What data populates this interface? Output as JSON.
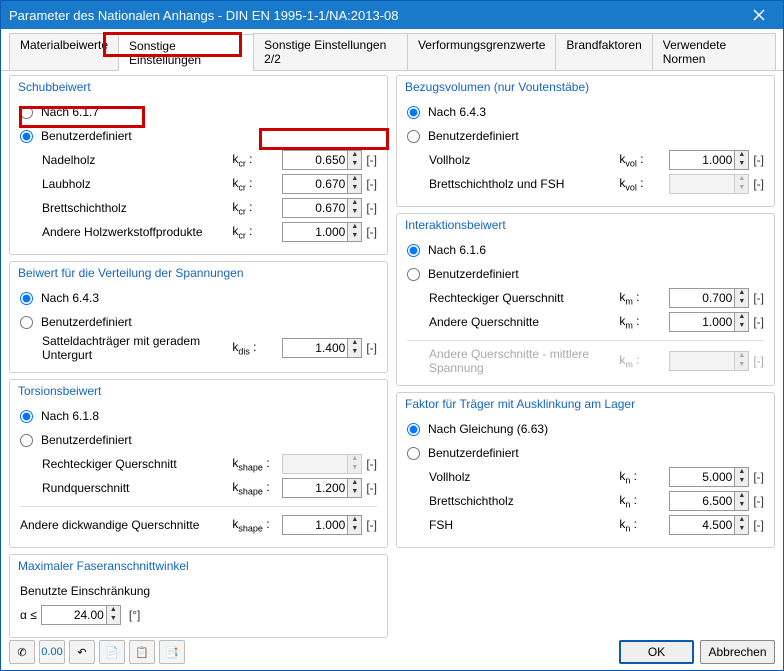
{
  "window": {
    "title": "Parameter des Nationalen Anhangs - DIN EN 1995-1-1/NA:2013-08"
  },
  "tabs": [
    "Materialbeiwerte",
    "Sonstige Einstellungen",
    "Sonstige Einstellungen 2/2",
    "Verformungsgrenzwerte",
    "Brandfaktoren",
    "Verwendete Normen"
  ],
  "groups": {
    "schub": {
      "title": "Schubbeiwert",
      "opt_a": "Nach 6.1.7",
      "opt_b": "Benutzerdefiniert",
      "rows": [
        {
          "label": "Nadelholz",
          "sym": "k<sub>cr</sub> :",
          "val": "0.650",
          "unit": "[-]"
        },
        {
          "label": "Laubholz",
          "sym": "k<sub>cr</sub> :",
          "val": "0.670",
          "unit": "[-]"
        },
        {
          "label": "Brettschichtholz",
          "sym": "k<sub>cr</sub> :",
          "val": "0.670",
          "unit": "[-]"
        },
        {
          "label": "Andere Holzwerkstoffprodukte",
          "sym": "k<sub>cr</sub> :",
          "val": "1.000",
          "unit": "[-]"
        }
      ]
    },
    "vert": {
      "title": "Beiwert für die Verteilung der Spannungen",
      "opt_a": "Nach 6.4.3",
      "opt_b": "Benutzerdefiniert",
      "row": {
        "label": "Satteldachträger mit geradem Untergurt",
        "sym": "k<sub>dis</sub> :",
        "val": "1.400",
        "unit": "[-]"
      }
    },
    "tors": {
      "title": "Torsionsbeiwert",
      "opt_a": "Nach 6.1.8",
      "opt_b": "Benutzerdefiniert",
      "rows": [
        {
          "label": "Rechteckiger Querschnitt",
          "sym": "k<sub>shape</sub> :",
          "val": "",
          "unit": "[-]"
        },
        {
          "label": "Rundquerschnitt",
          "sym": "k<sub>shape</sub> :",
          "val": "1.200",
          "unit": "[-]"
        }
      ],
      "row2": {
        "label": "Andere dickwandige Querschnitte",
        "sym": "k<sub>shape</sub> :",
        "val": "1.000",
        "unit": "[-]"
      }
    },
    "faser": {
      "title": "Maximaler Faseranschnittwinkel",
      "label": "Benutzte Einschränkung",
      "sym": "α ≤",
      "val": "24.00",
      "unit": "[°]"
    },
    "bezug": {
      "title": "Bezugsvolumen (nur Voutenstäbe)",
      "opt_a": "Nach 6.4.3",
      "opt_b": "Benutzerdefiniert",
      "rows": [
        {
          "label": "Vollholz",
          "sym": "k<sub>vol</sub> :",
          "val": "1.000",
          "unit": "[-]"
        },
        {
          "label": "Brettschichtholz und FSH",
          "sym": "k<sub>vol</sub> :",
          "val": "",
          "unit": "[-]"
        }
      ]
    },
    "inter": {
      "title": "Interaktionsbeiwert",
      "opt_a": "Nach 6.1.6",
      "opt_b": "Benutzerdefiniert",
      "rows": [
        {
          "label": "Rechteckiger Querschnitt",
          "sym": "k<sub>m</sub> :",
          "val": "0.700",
          "unit": "[-]"
        },
        {
          "label": "Andere Querschnitte",
          "sym": "k<sub>m</sub> :",
          "val": "1.000",
          "unit": "[-]"
        }
      ],
      "disabled_row": {
        "label": "Andere Querschnitte - mittlere Spannung",
        "sym": "k<sub>m</sub> :",
        "val": "",
        "unit": "[-]"
      }
    },
    "ausk": {
      "title": "Faktor für Träger mit Ausklinkung am Lager",
      "opt_a": "Nach Gleichung (6.63)",
      "opt_b": "Benutzerdefiniert",
      "rows": [
        {
          "label": "Vollholz",
          "sym": "k<sub>n</sub> :",
          "val": "5.000",
          "unit": "[-]"
        },
        {
          "label": "Brettschichtholz",
          "sym": "k<sub>n</sub> :",
          "val": "6.500",
          "unit": "[-]"
        },
        {
          "label": "FSH",
          "sym": "k<sub>n</sub> :",
          "val": "4.500",
          "unit": "[-]"
        }
      ]
    }
  },
  "buttons": {
    "ok": "OK",
    "cancel": "Abbrechen"
  }
}
